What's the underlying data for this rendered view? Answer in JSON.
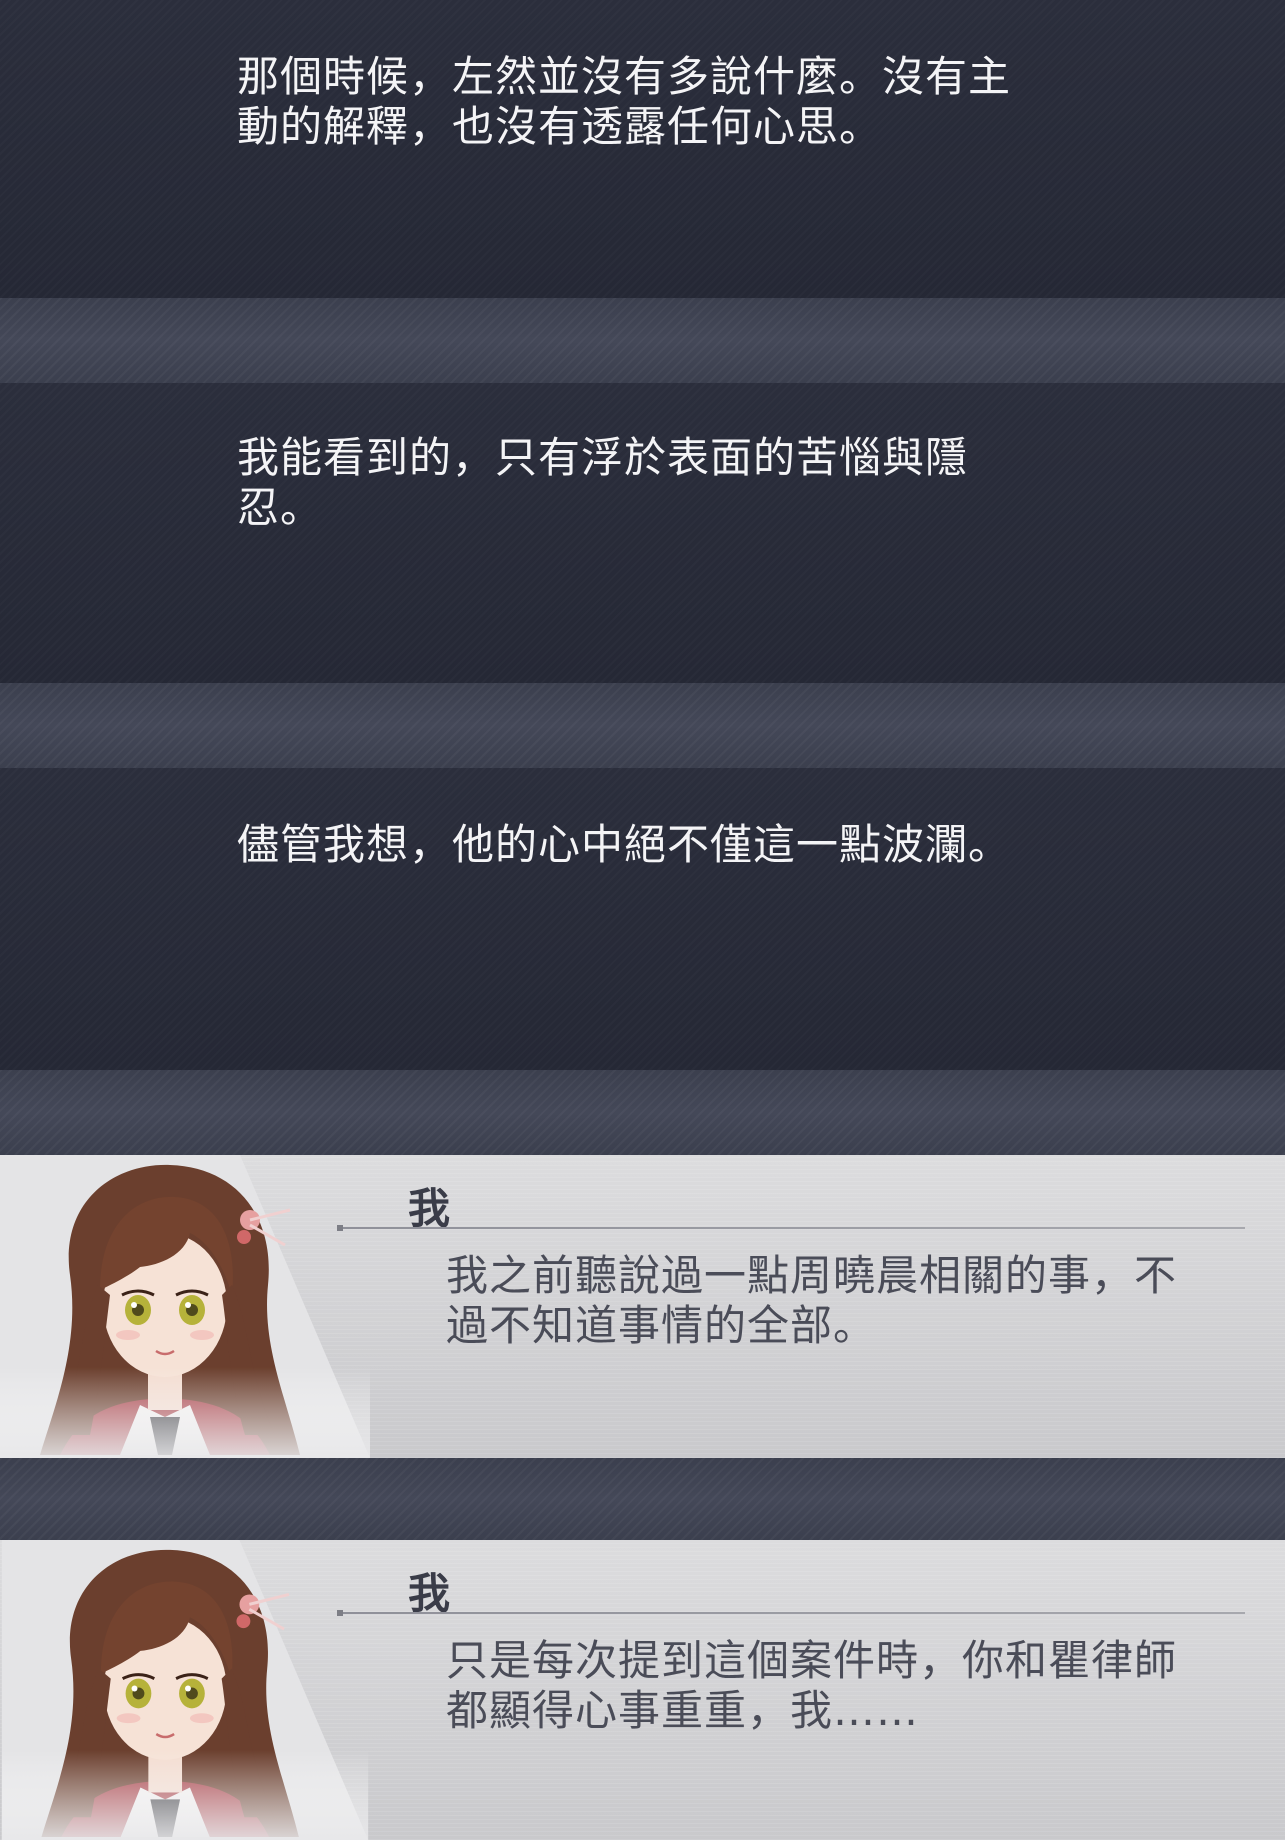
{
  "narration": [
    {
      "lines": [
        "那個時候，左然並沒有多說什麼。沒有主",
        "動的解釋，也沒有透露任何心思。"
      ]
    },
    {
      "lines": [
        "我能看到的，只有浮於表面的苦惱與隱",
        "忍。"
      ]
    },
    {
      "lines": [
        "儘管我想，他的心中絕不僅這一點波瀾。"
      ]
    }
  ],
  "dialogue": [
    {
      "speaker": "我",
      "lines": [
        "我之前聽說過一點周曉晨相關的事，不",
        "過不知道事情的全部。"
      ]
    },
    {
      "speaker": "我",
      "lines": [
        "只是每次提到這個案件時，你和瞿律師",
        "都顯得心事重重，我……"
      ]
    }
  ],
  "colors": {
    "narration_bg": "#282b38",
    "narration_text": "#f4f4f6",
    "dialogue_bg": "#d2d2d5",
    "dialogue_text": "#4a4c58",
    "hair": "#6b3f2e",
    "eyes": "#b6b23a",
    "jacket": "#a9434a"
  }
}
